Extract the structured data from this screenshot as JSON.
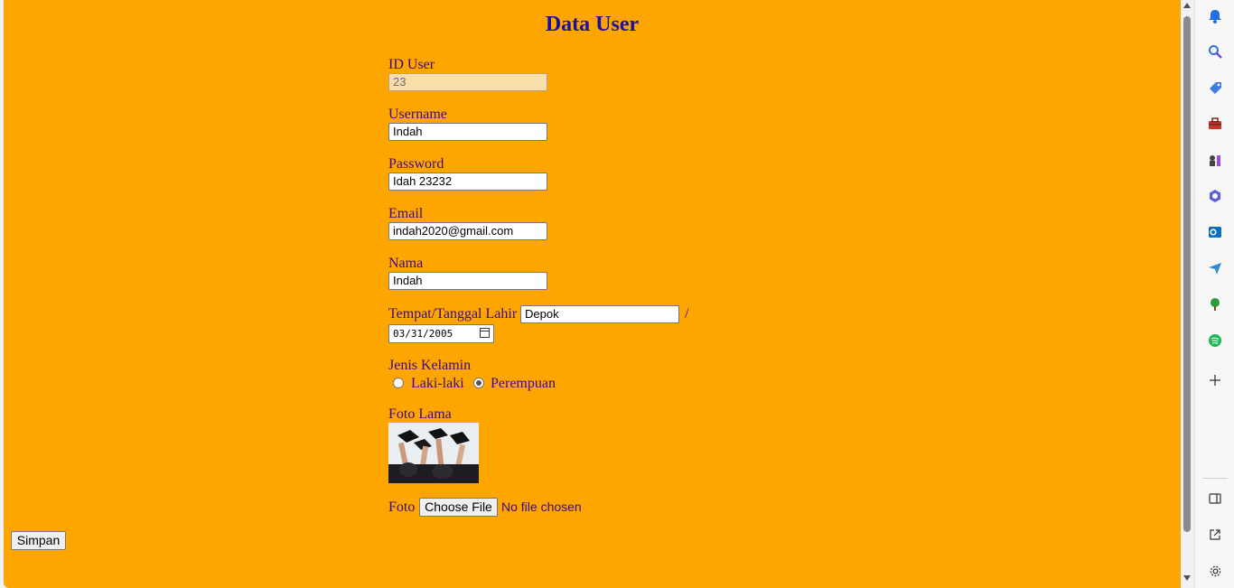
{
  "page": {
    "title": "Data User"
  },
  "form": {
    "id_user": {
      "label": "ID User",
      "value": "23"
    },
    "username": {
      "label": "Username",
      "value": "Indah"
    },
    "password": {
      "label": "Password",
      "value": "Idah 23232"
    },
    "email": {
      "label": "Email",
      "value": "indah2020@gmail.com"
    },
    "nama": {
      "label": "Nama",
      "value": "Indah"
    },
    "ttl": {
      "label": "Tempat/Tanggal Lahir",
      "tempat": "Depok",
      "separator": "/",
      "tanggal": "03/31/2005"
    },
    "gender": {
      "label": "Jenis Kelamin",
      "options": [
        "Laki-laki",
        "Perempuan"
      ],
      "selected": "Perempuan"
    },
    "foto_lama": {
      "label": "Foto Lama"
    },
    "foto": {
      "label": "Foto",
      "button": "Choose File",
      "status": "No file chosen"
    },
    "submit": "Simpan"
  },
  "sidebar": {
    "icons": [
      "bell-icon",
      "search-icon",
      "tag-icon",
      "toolbox-icon",
      "chess-icon",
      "copilot-icon",
      "outlook-icon",
      "send-icon",
      "tree-icon",
      "spotify-icon",
      "plus-icon",
      "split-panel-icon",
      "open-external-icon",
      "settings-icon"
    ]
  },
  "colors": {
    "page_background": "#FFA500",
    "title": "#1a0fa0",
    "text": "#3a0a8a"
  }
}
